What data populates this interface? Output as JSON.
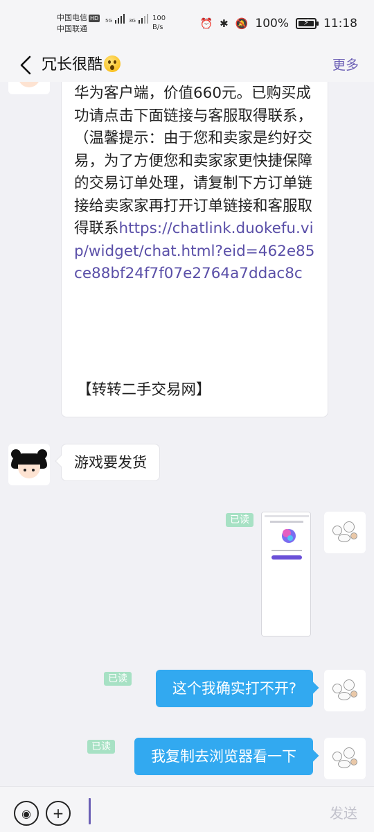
{
  "status_bar": {
    "carrier_1": "中国电信",
    "hd_label": "HD",
    "carrier_2": "中国联通",
    "gen_1": "5G",
    "gen_2": "3G",
    "net_speed_value": "100",
    "net_speed_unit": "B/s",
    "battery_percent": "100%",
    "time": "11:18"
  },
  "header": {
    "title": "冗长很酷",
    "more_label": "更多"
  },
  "messages": {
    "long_message": {
      "text": "华为客户端，价值660元。已购买成功请点击下面链接与客服取得联系，（温馨提示：由于您和卖家是约好交易，为了方便您和卖家家更快捷保障的交易订单处理，请复制下方订单链接给卖家家再打开订单链接和客服取得联系",
      "link": "https://chatlink.duokefu.vip/widget/chat.html?eid=462e85ce88bf24f7f07e2764a7ddac8c",
      "signature": "【转转二手交易网】"
    },
    "msg_2": "游戏要发货",
    "read_1": "已读",
    "msg_3": "这个我确实打不开?",
    "read_2": "已读",
    "msg_4": "我复制去浏览器看一下",
    "read_3": "已读"
  },
  "input_bar": {
    "send_label": "发送"
  },
  "colors": {
    "accent": "#6b5fb5",
    "bubble_blue": "#32a9f0",
    "read_badge": "#a7e1c4",
    "link": "#5a4fa8"
  }
}
